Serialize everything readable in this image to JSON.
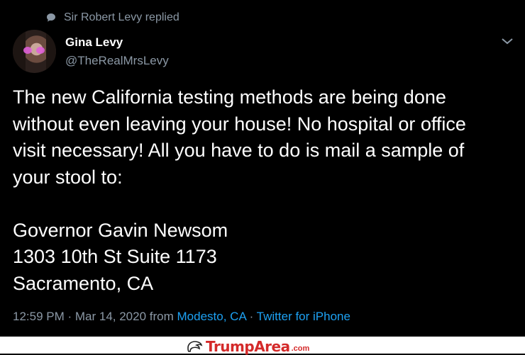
{
  "social_context": {
    "text": "Sir Robert Levy replied",
    "icon": "speech-bubble-icon"
  },
  "author": {
    "name": "Gina Levy",
    "handle": "@TheRealMrsLevy"
  },
  "tweet": {
    "text": "The new California testing methods are being done\nwithout even leaving your house! No hospital or office\nvisit necessary! All you have to do is mail a sample of\nyour stool to:\n\nGovernor Gavin Newsom\n1303 10th St   Suite 1173\nSacramento, CA"
  },
  "meta": {
    "timestamp": "12:59 PM · Mar 14, 2020",
    "from_label": "from",
    "location": "Modesto, CA",
    "separator": "·",
    "source": "Twitter for iPhone"
  },
  "watermark": {
    "brand": "TrumpArea",
    "tld": ".com"
  },
  "colors": {
    "background": "#000000",
    "text": "#ffffff",
    "secondary": "#8b98a5",
    "link": "#1da1f2",
    "brand_red": "#d42a2a"
  }
}
